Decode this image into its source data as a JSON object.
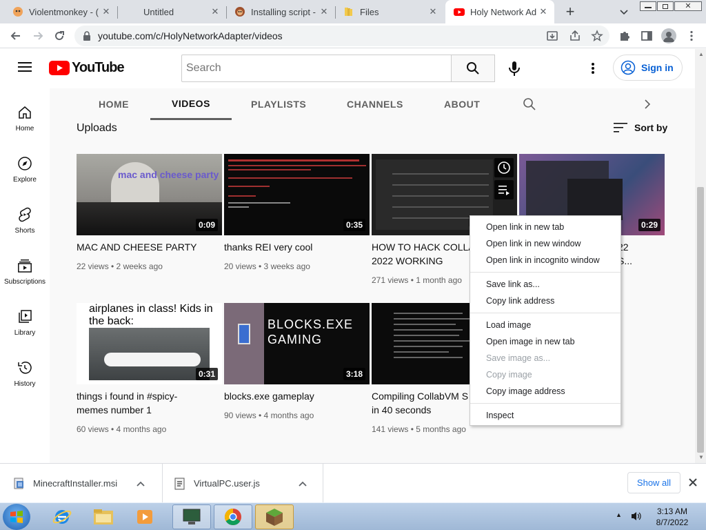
{
  "browser": {
    "tabs": [
      {
        "label": "Violentmonkey - (",
        "icon": "violentmonkey-icon"
      },
      {
        "label": "Untitled",
        "icon": "blank-page-icon"
      },
      {
        "label": "Installing script - (",
        "icon": "tampermonkey-icon"
      },
      {
        "label": "Files",
        "icon": "folder-icon"
      },
      {
        "label": "Holy Network Ad",
        "icon": "youtube-icon"
      }
    ],
    "url": "youtube.com/c/HolyNetworkAdapter/videos"
  },
  "youtube": {
    "logo_text": "YouTube",
    "search_placeholder": "Search",
    "sign_in": "Sign in",
    "sidebar": [
      {
        "label": "Home",
        "icon": "home-icon"
      },
      {
        "label": "Explore",
        "icon": "compass-icon"
      },
      {
        "label": "Shorts",
        "icon": "shorts-icon"
      },
      {
        "label": "Subscriptions",
        "icon": "subscriptions-icon"
      },
      {
        "label": "Library",
        "icon": "library-icon"
      },
      {
        "label": "History",
        "icon": "history-icon"
      }
    ],
    "channel_tabs": [
      "HOME",
      "VIDEOS",
      "PLAYLISTS",
      "CHANNELS",
      "ABOUT"
    ],
    "section_title": "Uploads",
    "sort_label": "Sort by",
    "videos": [
      {
        "title_lines": [
          "MAC AND CHEESE PARTY"
        ],
        "meta": "22 views • 2 weeks ago",
        "duration": "0:09",
        "thumb_text": "mac and cheese party"
      },
      {
        "title_lines": [
          "thanks REI very cool"
        ],
        "meta": "20 views • 3 weeks ago",
        "duration": "0:35",
        "thumb_text": ""
      },
      {
        "title_lines": [
          "HOW TO HACK COLLA",
          "2022 WORKING"
        ],
        "meta": "271 views • 1 month ago",
        "duration": "",
        "thumb_text": ""
      },
      {
        "title_lines": [
          "22",
          "S..."
        ],
        "meta": "",
        "duration": "0:29",
        "thumb_text": ""
      },
      {
        "title_lines": [
          "things i found in #spicy-",
          "memes number 1"
        ],
        "meta": "60 views • 4 months ago",
        "duration": "0:31",
        "thumb_text": "airplanes in class! Kids in the back:"
      },
      {
        "title_lines": [
          "blocks.exe gameplay"
        ],
        "meta": "90 views • 4 months ago",
        "duration": "3:18",
        "thumb_text": "BLOCKS.EXE GAMING"
      },
      {
        "title_lines": [
          "Compiling CollabVM S",
          "in 40 seconds"
        ],
        "meta": "141 views • 5 months ago",
        "duration": "",
        "thumb_text": ""
      }
    ]
  },
  "context_menu": {
    "items": [
      {
        "label": "Open link in new tab",
        "enabled": true
      },
      {
        "label": "Open link in new window",
        "enabled": true
      },
      {
        "label": "Open link in incognito window",
        "enabled": true
      },
      {
        "label": "Save link as...",
        "enabled": true
      },
      {
        "label": "Copy link address",
        "enabled": true
      },
      {
        "label": "Load image",
        "enabled": true
      },
      {
        "label": "Open image in new tab",
        "enabled": true
      },
      {
        "label": "Save image as...",
        "enabled": false
      },
      {
        "label": "Copy image",
        "enabled": false
      },
      {
        "label": "Copy image address",
        "enabled": true
      },
      {
        "label": "Inspect",
        "enabled": true
      }
    ]
  },
  "downloads": {
    "items": [
      "MinecraftInstaller.msi",
      "VirtualPC.user.js"
    ],
    "show_all": "Show all"
  },
  "taskbar": {
    "time": "3:13 AM",
    "date": "8/7/2022"
  },
  "colors": {
    "youtube_red": "#ff0000",
    "link_blue": "#065fd4",
    "taskbar_blue": "#bcd0e8"
  }
}
